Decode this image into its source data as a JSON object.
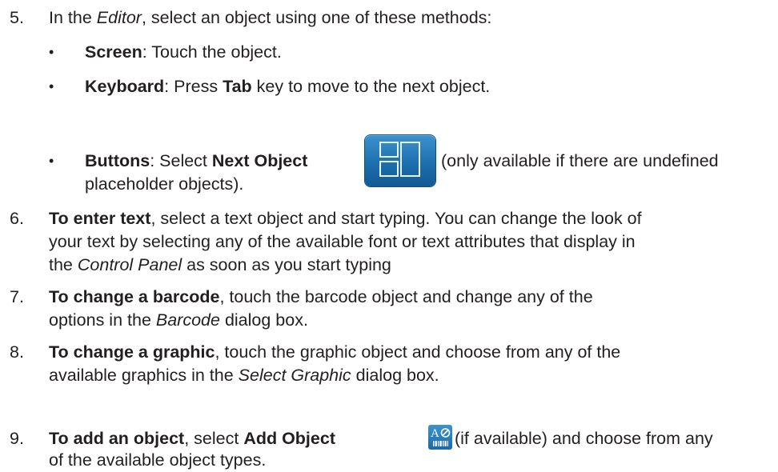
{
  "steps": [
    {
      "number": "5.",
      "pre": "In the ",
      "editor": "Editor",
      "post": ", select an object using one of these methods:",
      "bullets": [
        {
          "symbol": "•",
          "label": "Screen",
          "text": ": Touch the object."
        },
        {
          "symbol": "•",
          "label": "Keyboard",
          "text_pre": ": Press ",
          "key": "Tab",
          "text_post": " key to move to the next object."
        },
        {
          "symbol": "•",
          "label": "Buttons",
          "text_pre": ": Select ",
          "button": "Next Object",
          "text_post": " (only available if there are undefined",
          "line2": "placeholder objects)."
        }
      ]
    },
    {
      "number": "6.",
      "bold": "To enter text",
      "line1": ", select a text object and start typing. You can change the look of",
      "line2": "your text by selecting any of the available font or text attributes that display in",
      "line3_pre": "the ",
      "panel": "Control Panel",
      "line3_post": " as soon as you start typing"
    },
    {
      "number": "7.",
      "bold": "To change a barcode",
      "line1": ", touch the barcode object and change any of the",
      "line2_pre": "options in the ",
      "dialog": "Barcode",
      "line2_post": " dialog box."
    },
    {
      "number": "8.",
      "bold": "To change a graphic",
      "line1": ", touch the graphic object and choose from any of the",
      "line2_pre": "available graphics in the ",
      "dialog": "Select Graphic",
      "line2_post": " dialog box."
    },
    {
      "number": "9.",
      "bold": "To add an object",
      "pre": ", select ",
      "button": "Add Object",
      "post": " (if available) and choose from any",
      "line2": "of the available object types."
    }
  ],
  "icons": {
    "next_object": "next-object-icon",
    "add_object": "add-object-icon",
    "add_object_glyph": "A",
    "icon_color": "#1d6fae"
  }
}
